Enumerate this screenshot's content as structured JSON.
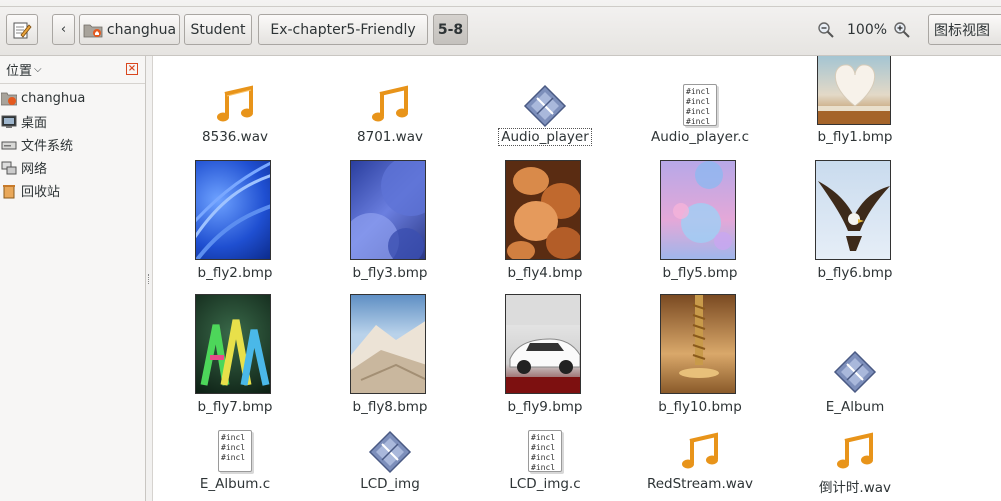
{
  "toolbar": {
    "breadcrumbs": [
      "changhua",
      "Student",
      "Ex-chapter5-Friendly",
      "5-8"
    ],
    "zoom_level": "100%",
    "view_mode": "图标视图"
  },
  "sidebar": {
    "header": "位置",
    "items": [
      {
        "label": "changhua",
        "icon": "home-folder-icon"
      },
      {
        "label": "桌面",
        "icon": "desktop-icon"
      },
      {
        "label": "文件系统",
        "icon": "filesystem-icon"
      },
      {
        "label": "网络",
        "icon": "network-icon"
      },
      {
        "label": "回收站",
        "icon": "trash-icon"
      }
    ]
  },
  "files": [
    {
      "name": "8536.wav",
      "type": "audio"
    },
    {
      "name": "8701.wav",
      "type": "audio"
    },
    {
      "name": "Audio_player",
      "type": "executable",
      "selected": true
    },
    {
      "name": "Audio_player.c",
      "type": "c-source"
    },
    {
      "name": "b_fly1.bmp",
      "type": "image"
    },
    {
      "name": "b_fly2.bmp",
      "type": "image"
    },
    {
      "name": "b_fly3.bmp",
      "type": "image"
    },
    {
      "name": "b_fly4.bmp",
      "type": "image"
    },
    {
      "name": "b_fly5.bmp",
      "type": "image"
    },
    {
      "name": "b_fly6.bmp",
      "type": "image"
    },
    {
      "name": "b_fly7.bmp",
      "type": "image"
    },
    {
      "name": "b_fly8.bmp",
      "type": "image"
    },
    {
      "name": "b_fly9.bmp",
      "type": "image"
    },
    {
      "name": "b_fly10.bmp",
      "type": "image"
    },
    {
      "name": "E_Album",
      "type": "executable"
    },
    {
      "name": "E_Album.c",
      "type": "c-source"
    },
    {
      "name": "LCD_img",
      "type": "executable"
    },
    {
      "name": "LCD_img.c",
      "type": "c-source"
    },
    {
      "name": "RedStream.wav",
      "type": "audio"
    },
    {
      "name": "倒计时.wav",
      "type": "audio"
    }
  ],
  "c_preview_text": [
    "#incl",
    "#incl",
    "#incl",
    "#incl"
  ],
  "colors": {
    "accent": "#d9461e",
    "note": "#e8941a",
    "exec": "#6f7fa8"
  }
}
